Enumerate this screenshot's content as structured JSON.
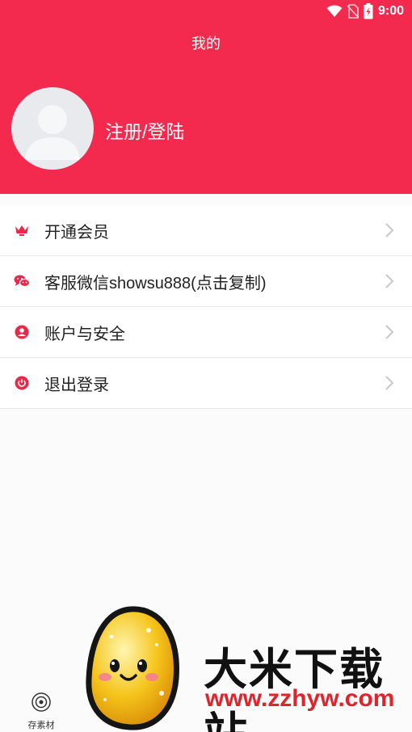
{
  "status_bar": {
    "time": "9:00",
    "icons": [
      "wifi-icon",
      "no-sim-icon",
      "battery-charging-icon"
    ]
  },
  "header": {
    "title": "我的",
    "login_text": "注册/登陆",
    "avatar_icon": "default-avatar-icon",
    "background_color": "#f3294d"
  },
  "menu": {
    "items": [
      {
        "label": "开通会员",
        "icon": "crown-icon"
      },
      {
        "label": "客服微信showsu888(点击复制)",
        "icon": "wechat-icon"
      },
      {
        "label": "账户与安全",
        "icon": "user-circle-icon"
      },
      {
        "label": "退出登录",
        "icon": "power-icon"
      }
    ],
    "icon_color": "#e8294a"
  },
  "bottom_nav": {
    "tab_label": "存素材",
    "tab_icon": "target-icon"
  },
  "watermark": {
    "title": "大米下载站",
    "url": "www.zzhyw.com"
  }
}
